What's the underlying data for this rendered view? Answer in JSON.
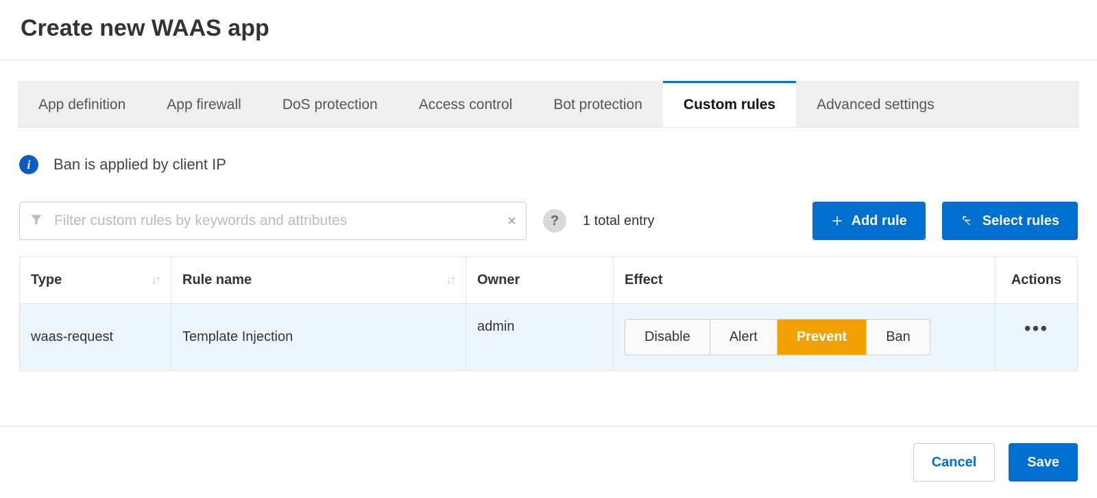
{
  "header": {
    "title": "Create new WAAS app"
  },
  "tabs": [
    {
      "label": "App definition",
      "active": false
    },
    {
      "label": "App firewall",
      "active": false
    },
    {
      "label": "DoS protection",
      "active": false
    },
    {
      "label": "Access control",
      "active": false
    },
    {
      "label": "Bot protection",
      "active": false
    },
    {
      "label": "Custom rules",
      "active": true
    },
    {
      "label": "Advanced settings",
      "active": false
    }
  ],
  "info": {
    "text": "Ban is applied by client IP"
  },
  "filter": {
    "placeholder": "Filter custom rules by keywords and attributes"
  },
  "entry_count": "1 total entry",
  "buttons": {
    "add_rule": "Add rule",
    "select_rules": "Select rules",
    "cancel": "Cancel",
    "save": "Save"
  },
  "table": {
    "headers": {
      "type": "Type",
      "rule_name": "Rule name",
      "owner": "Owner",
      "effect": "Effect",
      "actions": "Actions"
    },
    "effect_options": [
      "Disable",
      "Alert",
      "Prevent",
      "Ban"
    ],
    "rows": [
      {
        "type": "waas-request",
        "rule_name": "Template Injection",
        "owner": "admin",
        "effect_selected": "Prevent"
      }
    ]
  }
}
